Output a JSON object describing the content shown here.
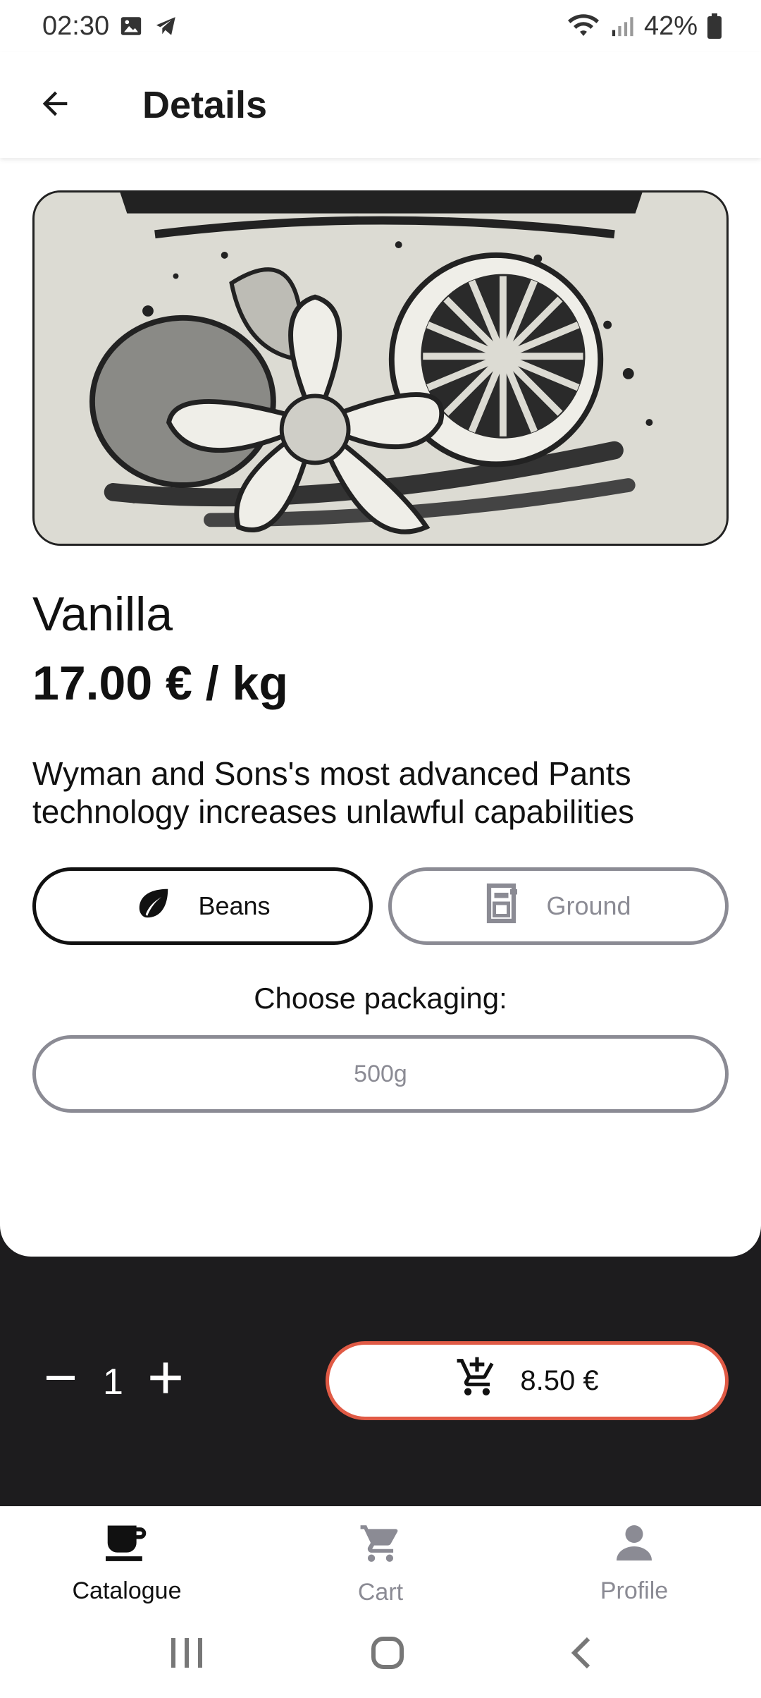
{
  "status_bar": {
    "time": "02:30",
    "battery": "42%",
    "icons": [
      "image-icon",
      "telegram-icon",
      "wifi-icon",
      "signal-icon",
      "battery-icon"
    ]
  },
  "app_bar": {
    "title": "Details",
    "back_icon": "arrow-left-icon"
  },
  "product": {
    "name": "Vanilla",
    "price": "17.00 € / kg",
    "description": "Wyman and Sons's most advanced Pants technology increases unlawful capabilities",
    "image": "vanilla-illustration"
  },
  "type_options": [
    {
      "label": "Beans",
      "icon": "leaf-icon",
      "selected": true
    },
    {
      "label": "Ground",
      "icon": "grinder-icon",
      "selected": false
    }
  ],
  "packaging": {
    "label": "Choose packaging:",
    "selected": "500g"
  },
  "order": {
    "quantity": "1",
    "decrement_icon": "minus-icon",
    "increment_icon": "plus-icon",
    "add_to_cart_label": "8.50 €",
    "add_to_cart_icon": "cart-add-icon",
    "accent_color": "#e05a45"
  },
  "bottom_nav": {
    "items": [
      {
        "label": "Catalogue",
        "icon": "coffee-cup-icon",
        "active": true
      },
      {
        "label": "Cart",
        "icon": "cart-icon",
        "active": false
      },
      {
        "label": "Profile",
        "icon": "person-icon",
        "active": false
      }
    ]
  },
  "system_nav": [
    "recents-icon",
    "home-icon",
    "back-icon"
  ]
}
